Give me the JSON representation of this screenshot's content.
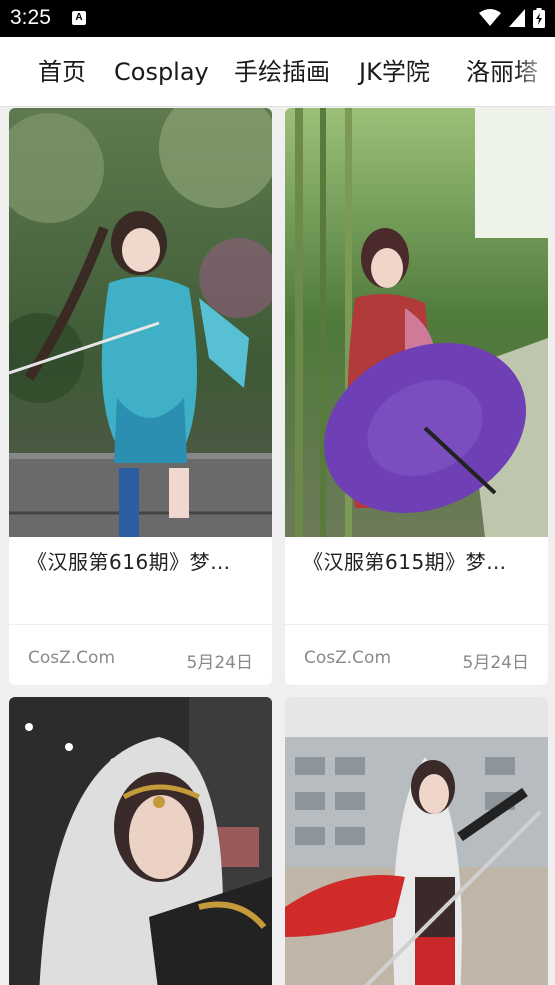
{
  "status_bar": {
    "time": "3:25",
    "notification_icon": "A",
    "icons": [
      "wifi-icon",
      "cell-signal-icon",
      "battery-icon"
    ]
  },
  "tabs": [
    {
      "label": "首页"
    },
    {
      "label": "Cosplay"
    },
    {
      "label": "手绘插画"
    },
    {
      "label": "JK学院"
    },
    {
      "label": "洛丽塔"
    }
  ],
  "cards": [
    {
      "title": "《汉服第616期》梦…",
      "source": "CosZ.Com",
      "date": "5月24日"
    },
    {
      "title": "《汉服第615期》梦…",
      "source": "CosZ.Com",
      "date": "5月24日"
    },
    {
      "title": "",
      "source": "",
      "date": ""
    },
    {
      "title": "",
      "source": "",
      "date": ""
    }
  ],
  "colors": {
    "background": "#efefef",
    "card": "#ffffff",
    "text_primary": "#222222",
    "text_secondary": "#8a8a8a"
  }
}
